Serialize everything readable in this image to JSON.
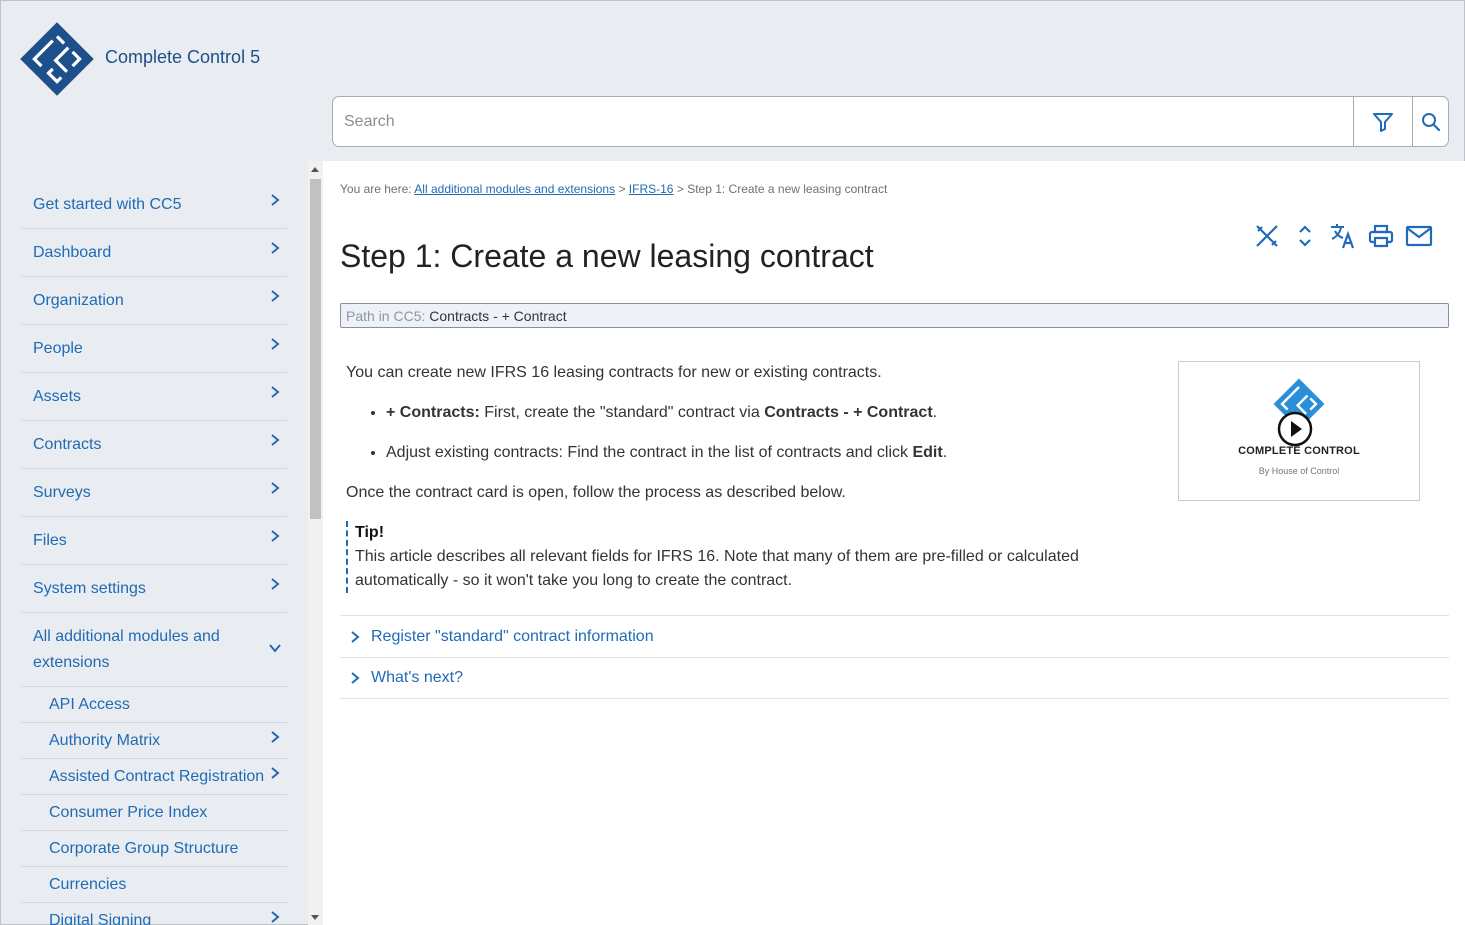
{
  "header": {
    "app_title": "Complete Control 5",
    "search_placeholder": "Search"
  },
  "sidebar": {
    "items": [
      {
        "label": "Get started with CC5"
      },
      {
        "label": "Dashboard"
      },
      {
        "label": "Organization"
      },
      {
        "label": "People"
      },
      {
        "label": "Assets"
      },
      {
        "label": "Contracts"
      },
      {
        "label": "Surveys"
      },
      {
        "label": "Files"
      },
      {
        "label": "System settings"
      },
      {
        "label": "All additional modules and extensions"
      }
    ],
    "sub_items": [
      {
        "label": "API Access"
      },
      {
        "label": "Authority Matrix"
      },
      {
        "label": "Assisted Contract Registration"
      },
      {
        "label": "Consumer Price Index"
      },
      {
        "label": "Corporate Group Structure"
      },
      {
        "label": "Currencies"
      },
      {
        "label": "Digital Signing"
      }
    ]
  },
  "breadcrumb": {
    "prefix": "You are here:",
    "link1": "All additional modules and extensions",
    "sep": ">",
    "link2": "IFRS-16",
    "current": "Step 1: Create a new leasing contract"
  },
  "page": {
    "title": "Step 1: Create a new leasing contract",
    "path_label": "Path in CC5:",
    "path_value": "Contracts - + Contract",
    "intro": "You can create new IFRS 16 leasing contracts for new or existing contracts.",
    "bullet1_bold": "+ Contracts:",
    "bullet1_text": "First, create the \"standard\" contract via",
    "bullet1_bold2": "Contracts - + Contract",
    "bullet2_text": "Adjust existing contracts: Find the contract in the list of contracts and click",
    "bullet2_bold": "Edit",
    "outro": "Once the contract card is open, follow the process as described below.",
    "tip_title": "Tip!",
    "tip_text": "This article describes all relevant fields for IFRS 16. Note that many of them are pre-filled or calculated automatically - so it won't take you long to create the contract.",
    "video_brand": "COMPLETE CONTROL",
    "video_sub": "By House of Control",
    "accordions": [
      {
        "label": "Register \"standard\" contract information"
      },
      {
        "label": "What's next?"
      }
    ]
  },
  "colors": {
    "brand": "#1d4f8b",
    "link": "#1f6bb6",
    "header_bg": "#e9ecf0"
  }
}
